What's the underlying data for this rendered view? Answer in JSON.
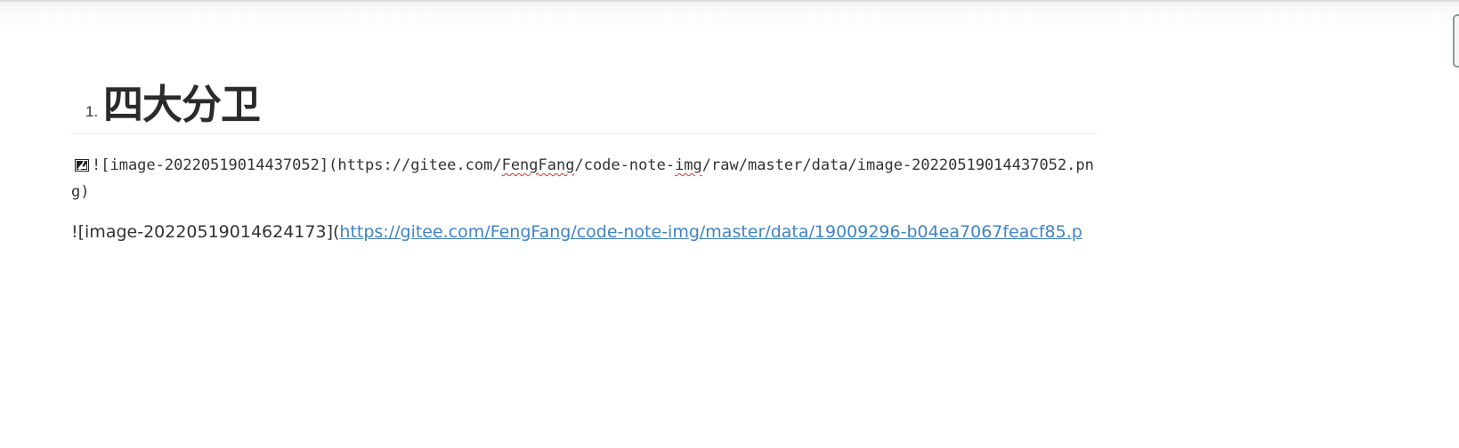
{
  "heading": {
    "list_number": "1.",
    "title": "四大分卫"
  },
  "code_block": {
    "icon": "broken-image-icon",
    "prefix": "![image-20220519014437052](https://gitee.com/",
    "misspelled_1": "FengFang",
    "middle": "/code-note-",
    "misspelled_2": "img",
    "suffix": "/raw/master/data/image-20220519014437052.png)"
  },
  "markdown_line": {
    "text_prefix": "![image-20220519014624173](",
    "link_text": "https://gitee.com/FengFang/code-note-img/master/data/19009296-b04ea7067feacf85.p"
  },
  "colors": {
    "link": "#4183c4",
    "text": "#333333",
    "spellcheck": "#e03030"
  }
}
